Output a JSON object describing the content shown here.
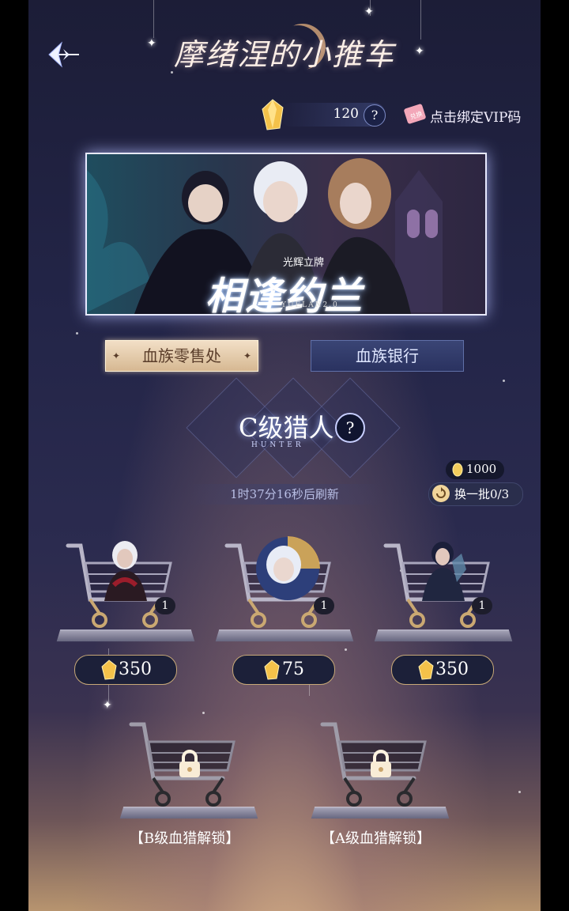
{
  "header": {
    "title": "摩绪涅的小推车",
    "back_icon": "back-arrow-icon"
  },
  "currency": {
    "icon": "gem-icon",
    "value": "120",
    "help": "?",
    "vip_icon": "vip-ticket-icon",
    "vip_badge": "兑换",
    "vip_label": "点击绑定VIP码"
  },
  "banner": {
    "subtitle": "光辉立牌",
    "title": "相逢约兰",
    "english": "YUELAN2.0"
  },
  "tabs": [
    {
      "label": "血族零售处",
      "active": true
    },
    {
      "label": "血族银行",
      "active": false
    }
  ],
  "hunter": {
    "rank": "C级猎人",
    "english": "HUNTER",
    "help": "?"
  },
  "refresh": {
    "countdown": "1时37分16秒后刷新",
    "coin_icon": "coin-icon",
    "coin_value": "1000",
    "swap_icon": "refresh-icon",
    "swap_label": "换一批0/3"
  },
  "items": [
    {
      "qty": "1",
      "price": "350",
      "icon": "cart-icon"
    },
    {
      "qty": "1",
      "price": "75",
      "icon": "cart-icon"
    },
    {
      "qty": "1",
      "price": "350",
      "icon": "cart-icon"
    }
  ],
  "locked": [
    {
      "label": "【B级血猎解锁】",
      "icon": "lock-icon"
    },
    {
      "label": "【A级血猎解锁】",
      "icon": "lock-icon"
    }
  ],
  "colors": {
    "gold": "#c7a877",
    "active_tab": "#e6cdaa",
    "inactive_tab": "#333c6a"
  }
}
